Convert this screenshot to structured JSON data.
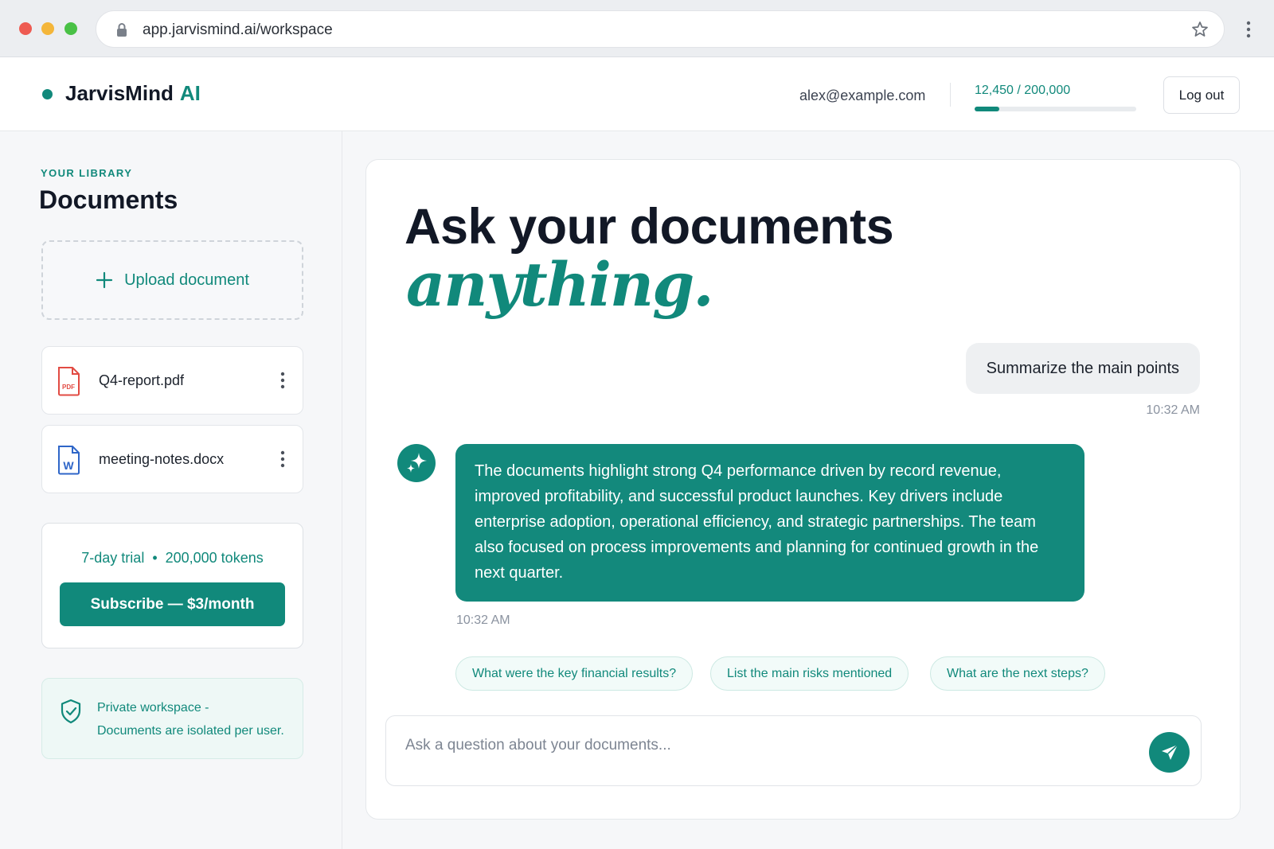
{
  "browser": {
    "url": "app.jarvismind.ai/workspace"
  },
  "header": {
    "brand_name": "JarvisMind",
    "brand_suffix": "AI",
    "user_email": "alex@example.com",
    "usage_label": "12,450 / 200,000",
    "usage_fraction": 0.06225,
    "logout_label": "Log out"
  },
  "sidebar": {
    "eyebrow": "YOUR LIBRARY",
    "title": "Documents",
    "upload_label": "Upload document",
    "documents": [
      {
        "name": "Q4-report.pdf",
        "icon": "pdf-file-icon"
      },
      {
        "name": "meeting-notes.docx",
        "icon": "word-file-icon"
      }
    ],
    "trial_text": "7-day trial  •  200,000 tokens",
    "subscribe_label": "Subscribe — $3/month",
    "privacy_title": "Private workspace -",
    "privacy_text": "Documents are isolated per user."
  },
  "main": {
    "hero_line1": "Ask your documents",
    "hero_line2": "anything.",
    "messages": [
      {
        "role": "user",
        "text": "Summarize the main points",
        "time": "10:32 AM"
      },
      {
        "role": "assistant",
        "text": "The documents highlight strong Q4 performance driven by record revenue, improved profitability, and successful product launches. Key drivers include enterprise adoption, operational efficiency, and strategic partnerships. The team also focused on process improvements and planning for continued growth in the next quarter.",
        "time": "10:32 AM"
      }
    ],
    "suggestions": [
      "What were the key financial results?",
      "List the main risks mentioned",
      "What are the next steps?"
    ],
    "composer_placeholder": "Ask a question about your documents..."
  },
  "colors": {
    "accent": "#11897b",
    "text": "#121826",
    "bubble_user": "#eef0f2"
  }
}
